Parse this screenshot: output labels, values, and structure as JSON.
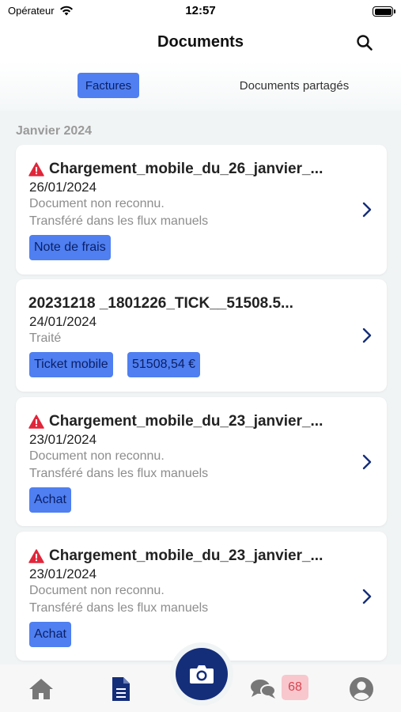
{
  "status_bar": {
    "carrier": "Opérateur",
    "time": "12:57"
  },
  "header": {
    "title": "Documents"
  },
  "segments": {
    "active": "Factures",
    "inactive": "Documents partagés"
  },
  "section": {
    "title": "Janvier 2024"
  },
  "documents": [
    {
      "title": "Chargement_mobile_du_26_janvier_...",
      "warning": true,
      "date": "26/01/2024",
      "line1": "Document non reconnu.",
      "line2": "Transféré dans les flux manuels",
      "tags": [
        "Note de frais"
      ]
    },
    {
      "title": "20231218 _1801226_TICK__51508.5...",
      "warning": false,
      "date": "24/01/2024",
      "line1": "Traité",
      "line2": "",
      "tags": [
        "Ticket mobile",
        "51508,54 €"
      ]
    },
    {
      "title": "Chargement_mobile_du_23_janvier_...",
      "warning": true,
      "date": "23/01/2024",
      "line1": "Document non reconnu.",
      "line2": "Transféré dans les flux manuels",
      "tags": [
        "Achat"
      ]
    },
    {
      "title": "Chargement_mobile_du_23_janvier_...",
      "warning": true,
      "date": "23/01/2024",
      "line1": "Document non reconnu.",
      "line2": "Transféré dans les flux manuels",
      "tags": [
        "Achat"
      ]
    }
  ],
  "tabbar": {
    "messages_badge": "68"
  },
  "colors": {
    "accent": "#4f7ff0",
    "navy": "#152e7a",
    "warning": "#e0263a",
    "badge_bg": "#f8c7cd",
    "badge_text": "#d9434e"
  },
  "icons": [
    "wifi-icon",
    "battery-icon",
    "search-icon",
    "warning-icon",
    "chevron-right-icon",
    "home-icon",
    "document-icon",
    "camera-icon",
    "chat-icon",
    "profile-icon"
  ]
}
